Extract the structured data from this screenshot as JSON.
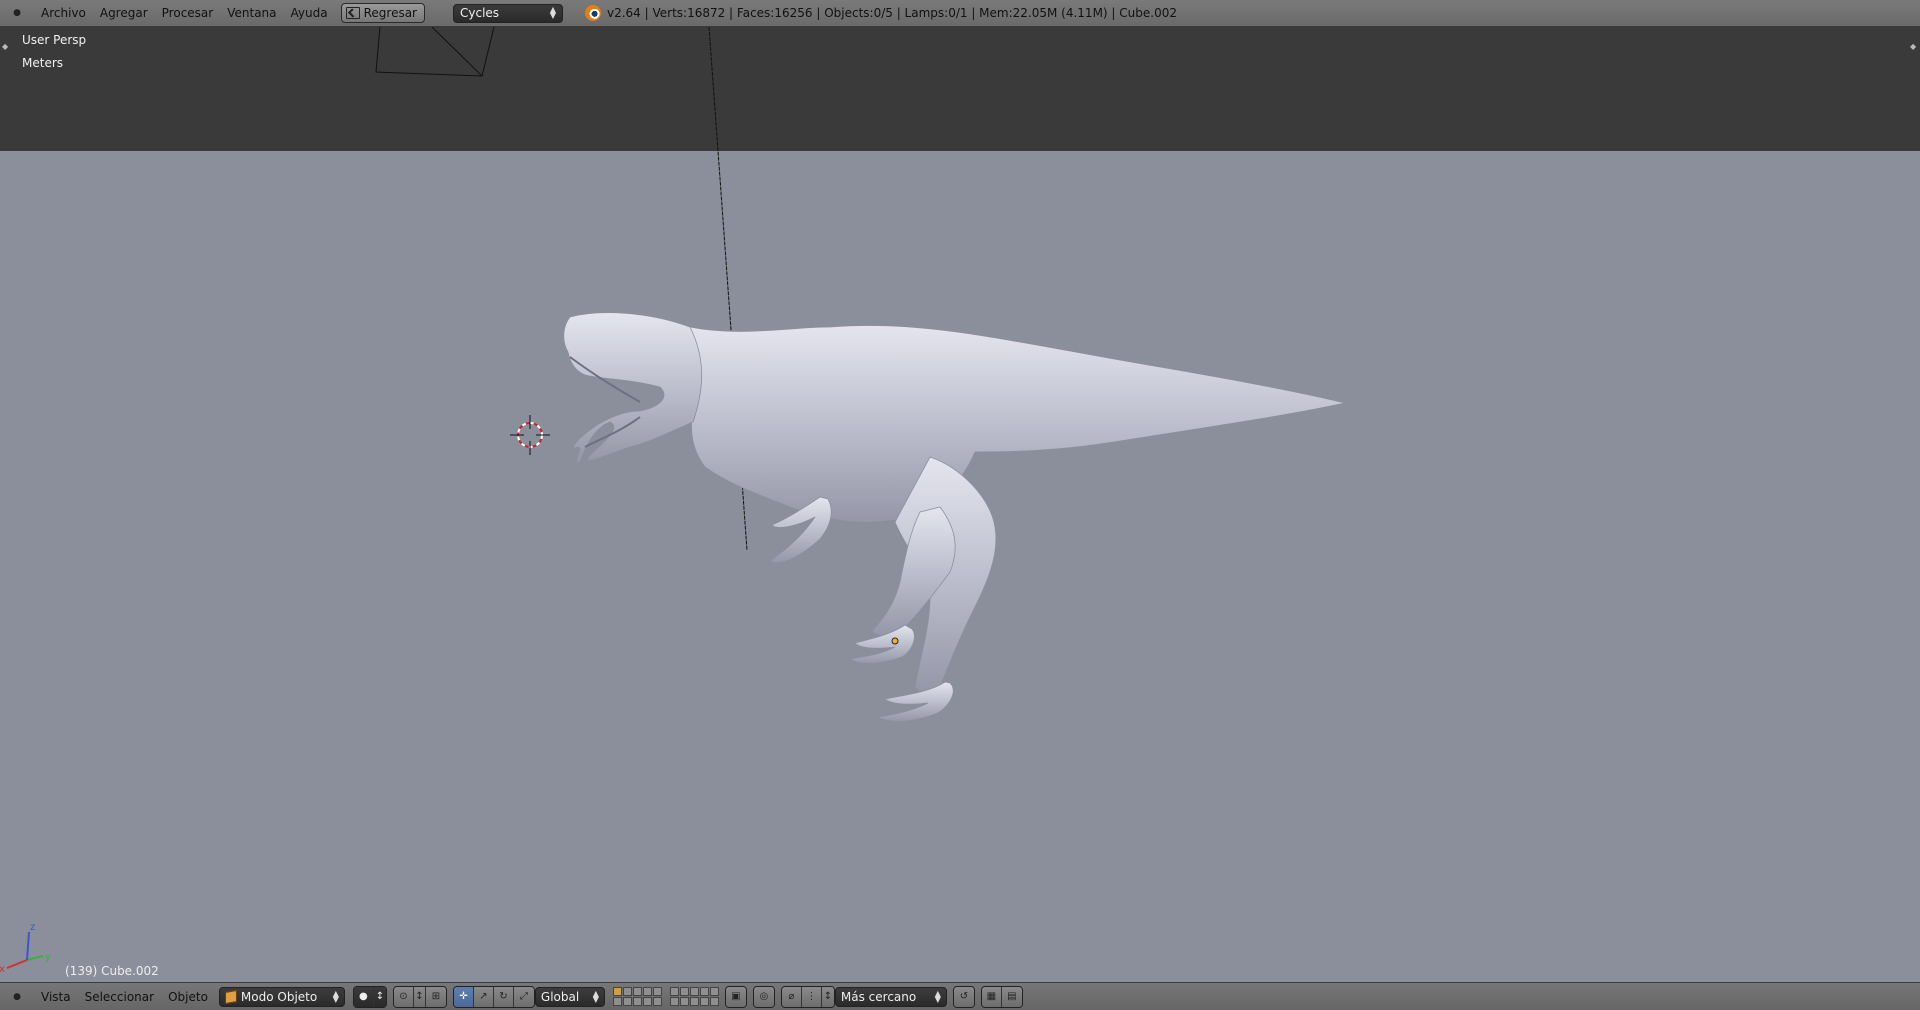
{
  "top_header": {
    "menus": [
      "Archivo",
      "Agregar",
      "Procesar",
      "Ventana",
      "Ayuda"
    ],
    "back_button": "Regresar",
    "render_engine": "Cycles",
    "stats": "v2.64 | Verts:16872 | Faces:16256 | Objects:0/5 | Lamps:0/1 | Mem:22.05M (4.11M) | Cube.002"
  },
  "viewport": {
    "view_name": "User Persp",
    "units": "Meters",
    "active_object_label": "(139) Cube.002",
    "axis_labels": {
      "x": "x",
      "y": "y",
      "z": "z"
    }
  },
  "bottom_header": {
    "menus": [
      "Vista",
      "Seleccionar",
      "Objeto"
    ],
    "mode": "Modo Objeto",
    "orientation": "Global",
    "snap_target": "Más cercano"
  },
  "colors": {
    "header_bg": "#707070",
    "world_dark": "#3a3a3a",
    "world_ground": "#8b8e9b",
    "model_tint": "#c9cad6",
    "accent_orange": "#e87d0d"
  },
  "icons": {
    "editor_type": "editor-type-icon",
    "blender": "blender-logo-icon",
    "object_mode": "cube-icon",
    "cursor": "3d-cursor-icon",
    "origin": "object-origin-icon"
  }
}
